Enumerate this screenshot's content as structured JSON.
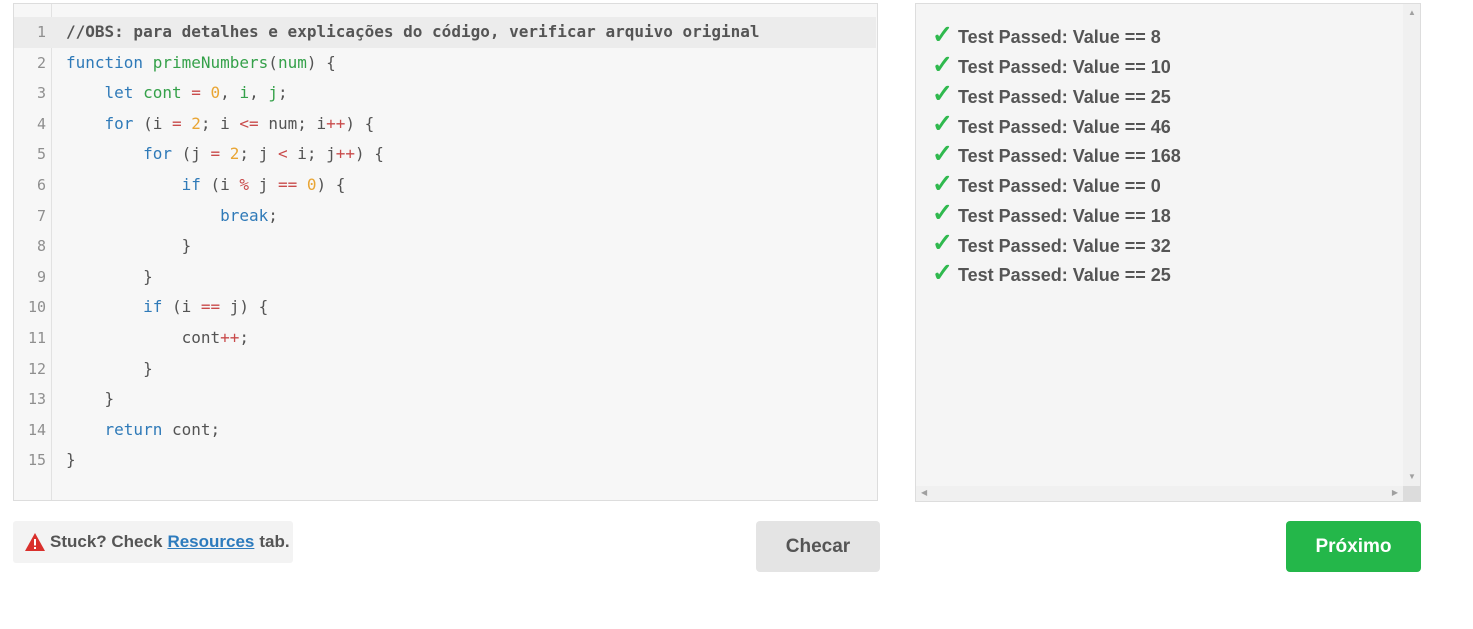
{
  "editor": {
    "lines": [
      [
        {
          "t": "//OBS: para detalhes e explicações do código, verificar arquivo original",
          "c": "cm"
        }
      ],
      [
        {
          "t": "function",
          "c": "kw"
        },
        {
          "t": " ",
          "c": "pl"
        },
        {
          "t": "primeNumbers",
          "c": "fn"
        },
        {
          "t": "(",
          "c": "pl"
        },
        {
          "t": "num",
          "c": "fn"
        },
        {
          "t": ") {",
          "c": "pl"
        }
      ],
      [
        {
          "t": "    ",
          "c": "pl"
        },
        {
          "t": "let",
          "c": "kw"
        },
        {
          "t": " ",
          "c": "pl"
        },
        {
          "t": "cont",
          "c": "fn"
        },
        {
          "t": " ",
          "c": "pl"
        },
        {
          "t": "=",
          "c": "op"
        },
        {
          "t": " ",
          "c": "pl"
        },
        {
          "t": "0",
          "c": "num"
        },
        {
          "t": ", ",
          "c": "pl"
        },
        {
          "t": "i",
          "c": "fn"
        },
        {
          "t": ", ",
          "c": "pl"
        },
        {
          "t": "j",
          "c": "fn"
        },
        {
          "t": ";",
          "c": "pl"
        }
      ],
      [
        {
          "t": "    ",
          "c": "pl"
        },
        {
          "t": "for",
          "c": "kw"
        },
        {
          "t": " (i ",
          "c": "pl"
        },
        {
          "t": "=",
          "c": "op"
        },
        {
          "t": " ",
          "c": "pl"
        },
        {
          "t": "2",
          "c": "num"
        },
        {
          "t": "; i ",
          "c": "pl"
        },
        {
          "t": "<=",
          "c": "op"
        },
        {
          "t": " num; i",
          "c": "pl"
        },
        {
          "t": "++",
          "c": "op"
        },
        {
          "t": ") {",
          "c": "pl"
        }
      ],
      [
        {
          "t": "        ",
          "c": "pl"
        },
        {
          "t": "for",
          "c": "kw"
        },
        {
          "t": " (j ",
          "c": "pl"
        },
        {
          "t": "=",
          "c": "op"
        },
        {
          "t": " ",
          "c": "pl"
        },
        {
          "t": "2",
          "c": "num"
        },
        {
          "t": "; j ",
          "c": "pl"
        },
        {
          "t": "<",
          "c": "op"
        },
        {
          "t": " i; j",
          "c": "pl"
        },
        {
          "t": "++",
          "c": "op"
        },
        {
          "t": ") {",
          "c": "pl"
        }
      ],
      [
        {
          "t": "            ",
          "c": "pl"
        },
        {
          "t": "if",
          "c": "kw"
        },
        {
          "t": " (i ",
          "c": "pl"
        },
        {
          "t": "%",
          "c": "op"
        },
        {
          "t": " j ",
          "c": "pl"
        },
        {
          "t": "==",
          "c": "op"
        },
        {
          "t": " ",
          "c": "pl"
        },
        {
          "t": "0",
          "c": "num"
        },
        {
          "t": ") {",
          "c": "pl"
        }
      ],
      [
        {
          "t": "                ",
          "c": "pl"
        },
        {
          "t": "break",
          "c": "kw"
        },
        {
          "t": ";",
          "c": "pl"
        }
      ],
      [
        {
          "t": "            }",
          "c": "pl"
        }
      ],
      [
        {
          "t": "        }",
          "c": "pl"
        }
      ],
      [
        {
          "t": "        ",
          "c": "pl"
        },
        {
          "t": "if",
          "c": "kw"
        },
        {
          "t": " (i ",
          "c": "pl"
        },
        {
          "t": "==",
          "c": "op"
        },
        {
          "t": " j) {",
          "c": "pl"
        }
      ],
      [
        {
          "t": "            cont",
          "c": "pl"
        },
        {
          "t": "++",
          "c": "op"
        },
        {
          "t": ";",
          "c": "pl"
        }
      ],
      [
        {
          "t": "        }",
          "c": "pl"
        }
      ],
      [
        {
          "t": "    }",
          "c": "pl"
        }
      ],
      [
        {
          "t": "    ",
          "c": "pl"
        },
        {
          "t": "return",
          "c": "kw"
        },
        {
          "t": " cont;",
          "c": "pl"
        }
      ],
      [
        {
          "t": "}",
          "c": "pl"
        }
      ]
    ]
  },
  "output": {
    "check_glyph": "✓",
    "results": [
      "Test Passed: Value == 8",
      "Test Passed: Value == 10",
      "Test Passed: Value == 25",
      "Test Passed: Value == 46",
      "Test Passed: Value == 168",
      "Test Passed: Value == 0",
      "Test Passed: Value == 18",
      "Test Passed: Value == 32",
      "Test Passed: Value == 25"
    ]
  },
  "help": {
    "prefix": "Stuck? Check",
    "link": "Resources",
    "suffix": "tab.",
    "icon": "warning-icon"
  },
  "buttons": {
    "check_label": "Checar",
    "next_label": "Próximo"
  },
  "colors": {
    "keyword": "#2f7ab8",
    "function": "#35a14a",
    "number": "#e9a534",
    "operator": "#c94b4b",
    "success": "#2fb94e",
    "primary": "#24b74a",
    "link": "#2d7bbd",
    "warning": "#d9302c"
  }
}
